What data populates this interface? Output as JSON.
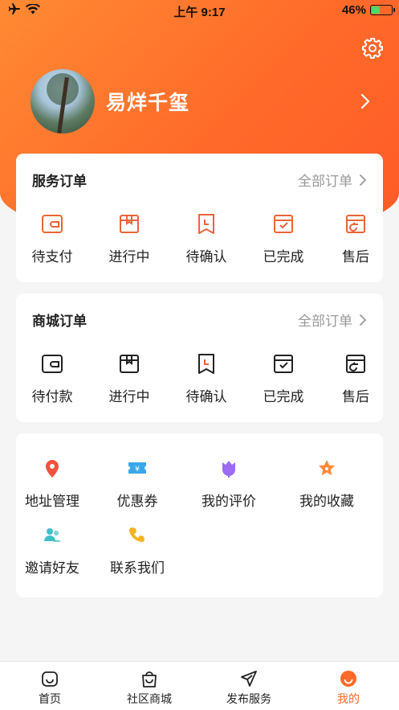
{
  "status_bar": {
    "time": "上午 9:17",
    "battery_percent": "46%",
    "battery_level": 0.46
  },
  "profile": {
    "name": "易烊千玺"
  },
  "service_orders": {
    "title": "服务订单",
    "all_label": "全部订单",
    "accent_color": "#e8653a",
    "items": [
      {
        "label": "待支付",
        "icon": "wallet-icon"
      },
      {
        "label": "进行中",
        "icon": "box-icon"
      },
      {
        "label": "待确认",
        "icon": "bookmark-clock-icon"
      },
      {
        "label": "已完成",
        "icon": "box-check-icon"
      },
      {
        "label": "售后",
        "icon": "box-return-icon"
      }
    ]
  },
  "mall_orders": {
    "title": "商城订单",
    "all_label": "全部订单",
    "accent_color": "#222222",
    "items": [
      {
        "label": "待付款",
        "icon": "wallet-icon"
      },
      {
        "label": "进行中",
        "icon": "box-icon"
      },
      {
        "label": "待确认",
        "icon": "bookmark-clock-icon"
      },
      {
        "label": "已完成",
        "icon": "box-check-icon"
      },
      {
        "label": "售后",
        "icon": "box-return-icon"
      }
    ]
  },
  "menu": {
    "items": [
      {
        "label": "地址管理",
        "icon": "location-pin-icon",
        "color": "#f0523d"
      },
      {
        "label": "优惠券",
        "icon": "coupon-icon",
        "color": "#3aa8e8"
      },
      {
        "label": "我的评价",
        "icon": "flower-icon",
        "color": "#9b6bf2"
      },
      {
        "label": "我的收藏",
        "icon": "star-icon",
        "color": "#ff8a3a"
      },
      {
        "label": "邀请好友",
        "icon": "users-icon",
        "color": "#3ec0c7"
      },
      {
        "label": "联系我们",
        "icon": "phone-icon",
        "color": "#f5b321"
      }
    ]
  },
  "tabbar": {
    "active_color": "#ff6a2a",
    "tabs": [
      {
        "label": "首页",
        "icon": "home-icon"
      },
      {
        "label": "社区商城",
        "icon": "shopping-bag-icon"
      },
      {
        "label": "发布服务",
        "icon": "send-icon"
      },
      {
        "label": "我的",
        "icon": "profile-smile-icon"
      }
    ]
  }
}
